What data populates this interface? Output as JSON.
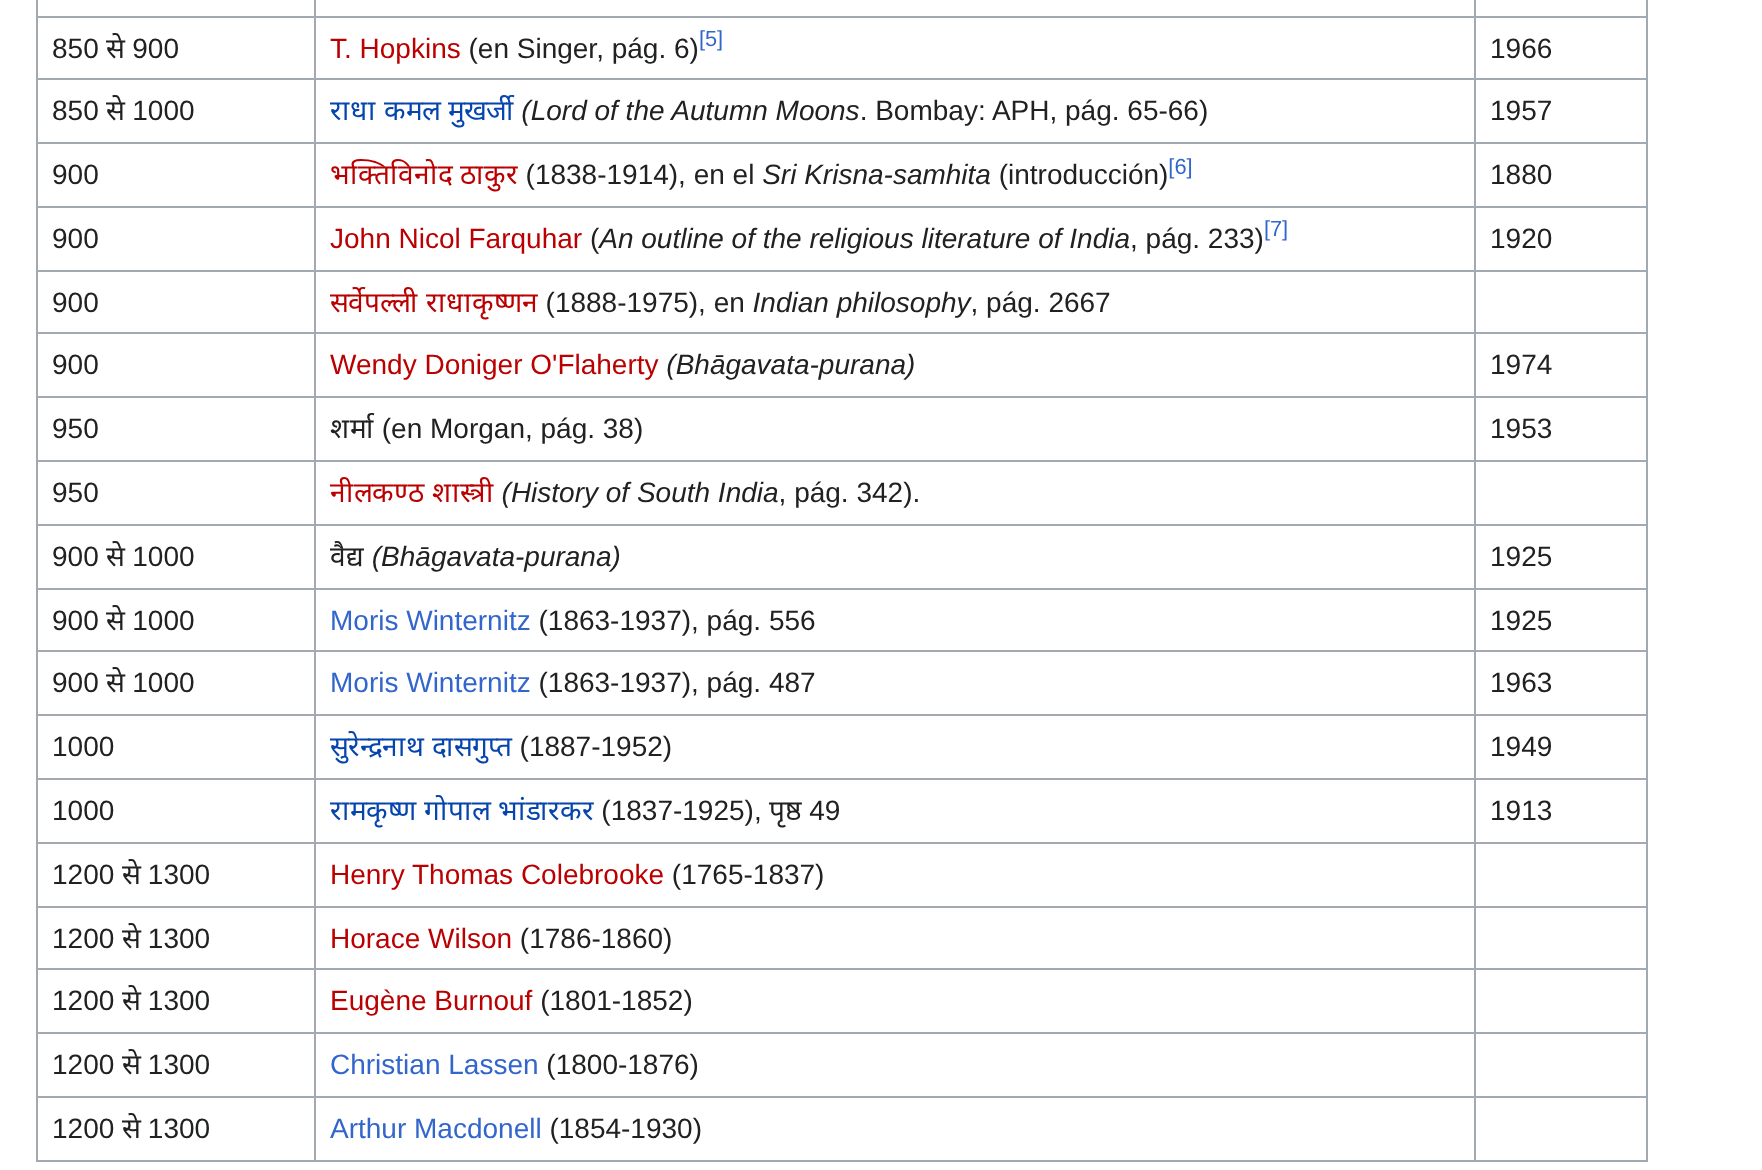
{
  "rows": [
    {
      "date": "850 से 900",
      "author": {
        "text": "T. Hopkins",
        "color": "#ba0000"
      },
      "reference": " (en Singer, pág. 6)$^{[5]}$",
      "year": "1966"
    },
    {
      "date": "850 से 1000",
      "author": {
        "text": "राधा कमल मुखर्जी",
        "color": "#0645ad"
      },
      "reference": " *(Lord of the Autumn Moons*. Bombay: APH, pág. 65-66)",
      "year": "1957"
    },
    {
      "date": "900",
      "author": {
        "text": "भक्तिविनोद ठाकुर",
        "color": "#ba0000"
      },
      "reference": " (1838-1914), en el *Sri Krisna-samhita* (introducción)$^{[6]}$",
      "year": "1880"
    },
    {
      "date": "900",
      "author": {
        "text": "John Nicol Farquhar",
        "color": "#ba0000"
      },
      "reference": " (*An outline of the religious literature of India*, pág. 233)$^{[7]}$",
      "year": "1920"
    },
    {
      "date": "900",
      "author": {
        "text": "सर्वेपल्ली राधाकृष्णन",
        "color": "#ba0000"
      },
      "reference": " (1888-1975), en *Indian philosophy*, pág. 2667",
      "year": ""
    },
    {
      "date": "900",
      "author": {
        "text": "Wendy Doniger O'Flaherty",
        "color": "#ba0000"
      },
      "reference": " *(Bhāgavata-purana)*",
      "year": "1974"
    },
    {
      "date": "950",
      "reference": "शर्मा (en Morgan, pág. 38)",
      "year": "1953"
    },
    {
      "date": "950",
      "author": {
        "text": "नीलकण्ठ शास्त्री",
        "color": "#ba0000"
      },
      "reference": " *(History of South India*, pág. 342).",
      "year": ""
    },
    {
      "date": "900 से 1000",
      "reference": "वैद्य *(Bhāgavata-purana)*",
      "year": "1925"
    },
    {
      "date": "900 से 1000",
      "author": {
        "text": "Moris Winternitz",
        "color": "#3366cc"
      },
      "reference": " (1863-1937), pág. 556",
      "year": "1925"
    },
    {
      "date": "900 से 1000",
      "author": {
        "text": "Moris Winternitz",
        "color": "#3366cc"
      },
      "reference": " (1863-1937), pág. 487",
      "year": "1963"
    },
    {
      "date": "1000",
      "author": {
        "text": "सुरेन्द्रनाथ दासगुप्त",
        "color": "#0645ad"
      },
      "reference": " (1887-1952)",
      "year": "1949"
    },
    {
      "date": "1000",
      "author": {
        "text": "रामकृष्ण गोपाल भांडारकर",
        "color": "#0645ad"
      },
      "reference": " (1837-1925), पृष्ठ 49",
      "year": "1913"
    },
    {
      "date": "1200 से 1300",
      "author": {
        "text": "Henry Thomas Colebrooke",
        "color": "#ba0000"
      },
      "reference": " (1765-1837)",
      "year": ""
    },
    {
      "date": "1200 से 1300",
      "author": {
        "text": "Horace Wilson",
        "color": "#ba0000"
      },
      "reference": " (1786-1860)",
      "year": ""
    },
    {
      "date": "1200 से 1300",
      "author": {
        "text": "Eugène Burnouf",
        "color": "#ba0000"
      },
      "reference": " (1801-1852)",
      "year": ""
    },
    {
      "date": "1200 से 1300",
      "author": {
        "text": "Christian Lassen",
        "color": "#3366cc"
      },
      "reference": " (1800-1876)",
      "year": ""
    },
    {
      "date": "1200 से 1300",
      "author": {
        "text": "Arthur Macdonell",
        "color": "#3366cc"
      },
      "reference": " (1854-1930)",
      "year": ""
    }
  ]
}
